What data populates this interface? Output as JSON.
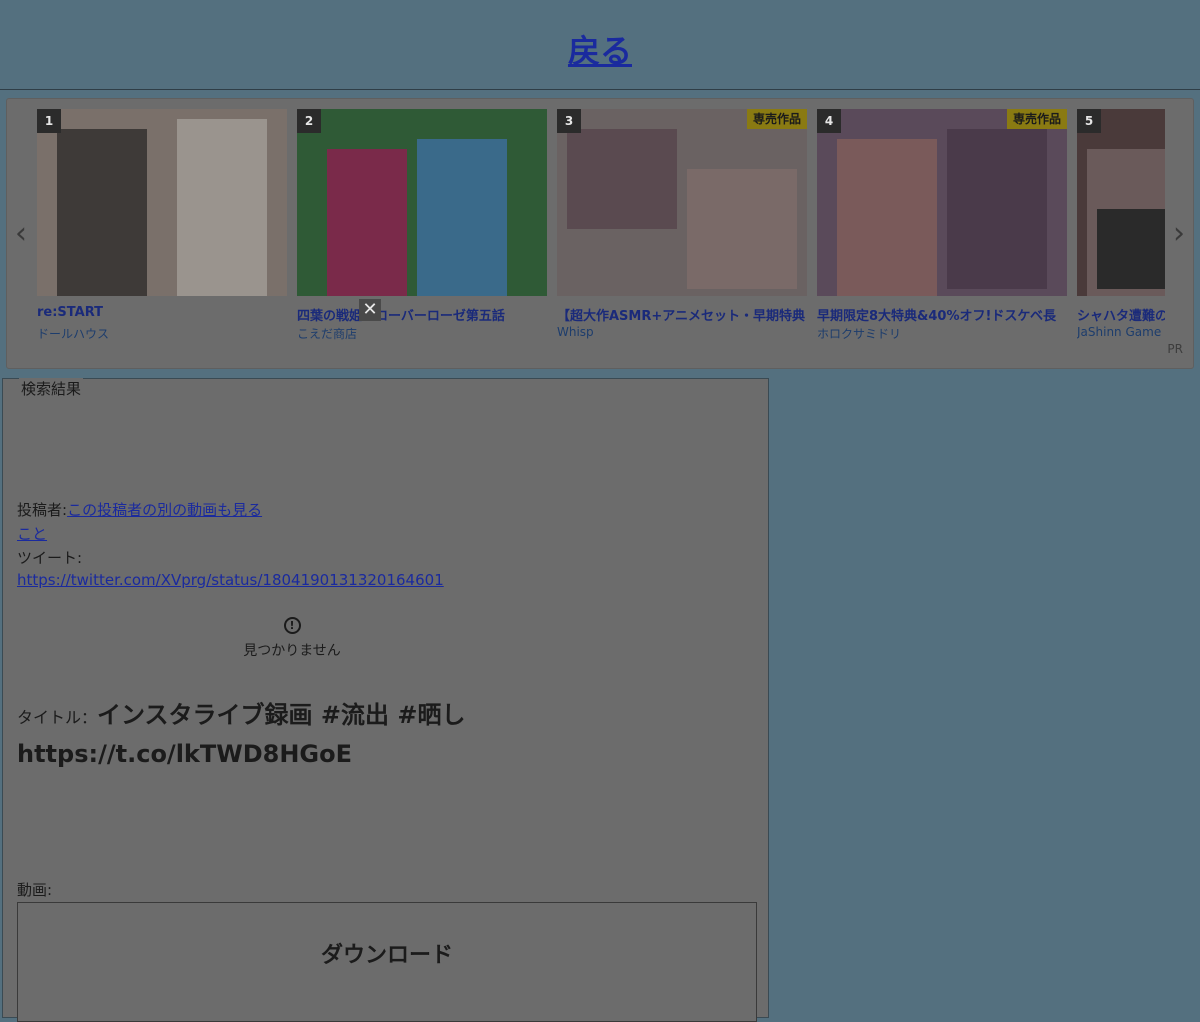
{
  "header": {
    "back_label": "戻る"
  },
  "ads": {
    "prev_icon": "‹",
    "next_icon": "›",
    "close_icon": "✕",
    "pr_label": "PR",
    "items": [
      {
        "rank": "1",
        "badge": "",
        "title": "re:START",
        "maker": "ドールハウス",
        "colors": [
          "#7a706a",
          "#3e3a38",
          "#9a948e"
        ]
      },
      {
        "rank": "2",
        "badge": "",
        "title": "四葉の戦姫クローバーローゼ第五話",
        "maker": "こえだ商店",
        "colors": [
          "#2f5a36",
          "#7a2a4a",
          "#3a6a8a"
        ]
      },
      {
        "rank": "3",
        "badge": "専売作品",
        "title": "【超大作ASMR+アニメセット・早期特典",
        "maker": "Whisp",
        "colors": [
          "#6a6262",
          "#5a4a50",
          "#7a6a68"
        ]
      },
      {
        "rank": "4",
        "badge": "専売作品",
        "title": "󠁧早期限定8大特典&40%オフ!󠁧ドスケベ長",
        "maker": "ホロクサミドリ",
        "colors": [
          "#5a4a5a",
          "#7a5a5a",
          "#4a3a4a"
        ]
      },
      {
        "rank": "5",
        "badge": "",
        "title": "シャハタ遭難の",
        "maker": "JaShinn Game",
        "colors": [
          "#4a3a3a",
          "#6a5a5a",
          "#2a2a2a"
        ]
      }
    ]
  },
  "results": {
    "legend": "検索結果",
    "poster_label": "投稿者:",
    "poster_link": "この投稿者の別の動画も見る",
    "poster_name": "こと",
    "tweet_label": "ツイート:",
    "tweet_url": "https://twitter.com/XVprg/status/1804190131320164601",
    "notfound_icon": "!",
    "notfound_text": "見つかりません",
    "title_label": "タイトル：",
    "title_value": "インスタライブ録画 #流出 #晒し https://t.co/lkTWD8HGoE",
    "video_label": "動画:",
    "download_label": "ダウンロード"
  }
}
